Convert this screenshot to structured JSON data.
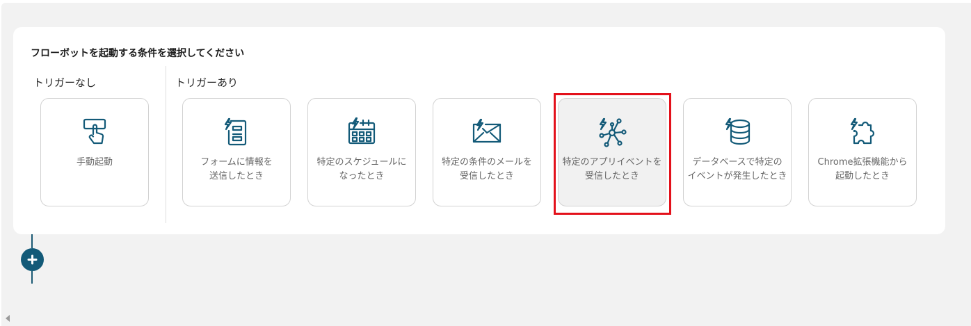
{
  "panel": {
    "title": "フローボットを起動する条件を選択してください",
    "no_trigger_label": "トリガーなし",
    "with_trigger_label": "トリガーあり"
  },
  "cards": [
    {
      "label": "手動起動",
      "icon": "hand-tap-icon",
      "selected": false
    },
    {
      "label": "フォームに情報を\n送信したとき",
      "icon": "form-icon",
      "selected": false
    },
    {
      "label": "特定のスケジュールに\nなったとき",
      "icon": "calendar-icon",
      "selected": false
    },
    {
      "label": "特定の条件のメールを\n受信したとき",
      "icon": "mail-icon",
      "selected": false
    },
    {
      "label": "特定のアプリイベントを\n受信したとき",
      "icon": "app-event-icon",
      "selected": true
    },
    {
      "label": "データベースで特定の\nイベントが発生したとき",
      "icon": "database-icon",
      "selected": false
    },
    {
      "label": "Chrome拡張機能から\n起動したとき",
      "icon": "puzzle-icon",
      "selected": false
    }
  ],
  "colors": {
    "icon": "#135a78",
    "accent": "#135a78",
    "highlight": "#e3111b"
  }
}
